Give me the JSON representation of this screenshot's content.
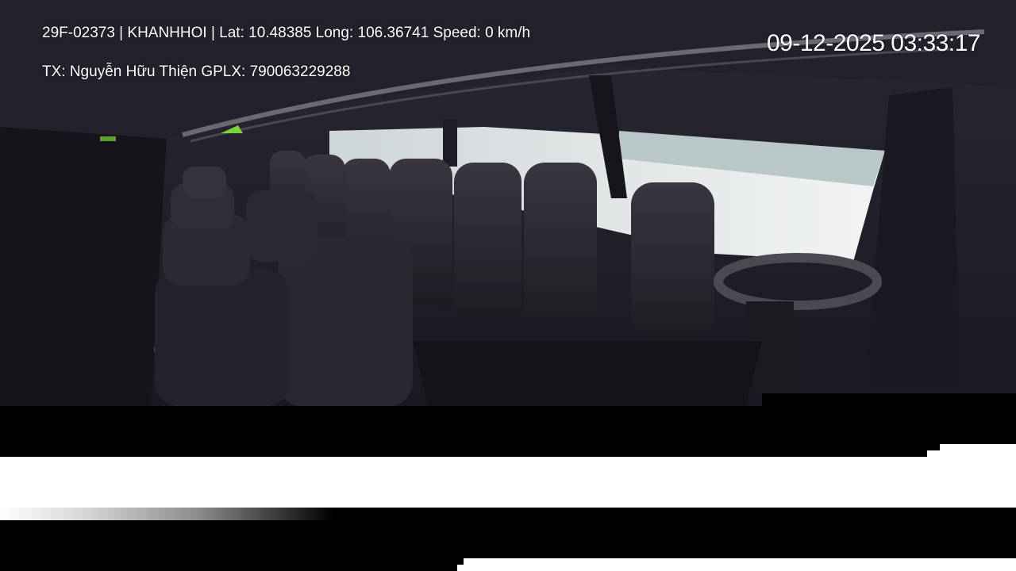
{
  "overlay": {
    "vehicle_info": "29F-02373 | KHANHHOI | Lat: 10.48385 Long: 106.36741 Speed: 0 km/h",
    "driver_info": "TX: Nguyễn Hữu Thiện GPLX: 790063229288",
    "datetime": "09-12-2025 03:33:17"
  },
  "scene": {
    "description_icon": "bus-interior-camera-view"
  }
}
